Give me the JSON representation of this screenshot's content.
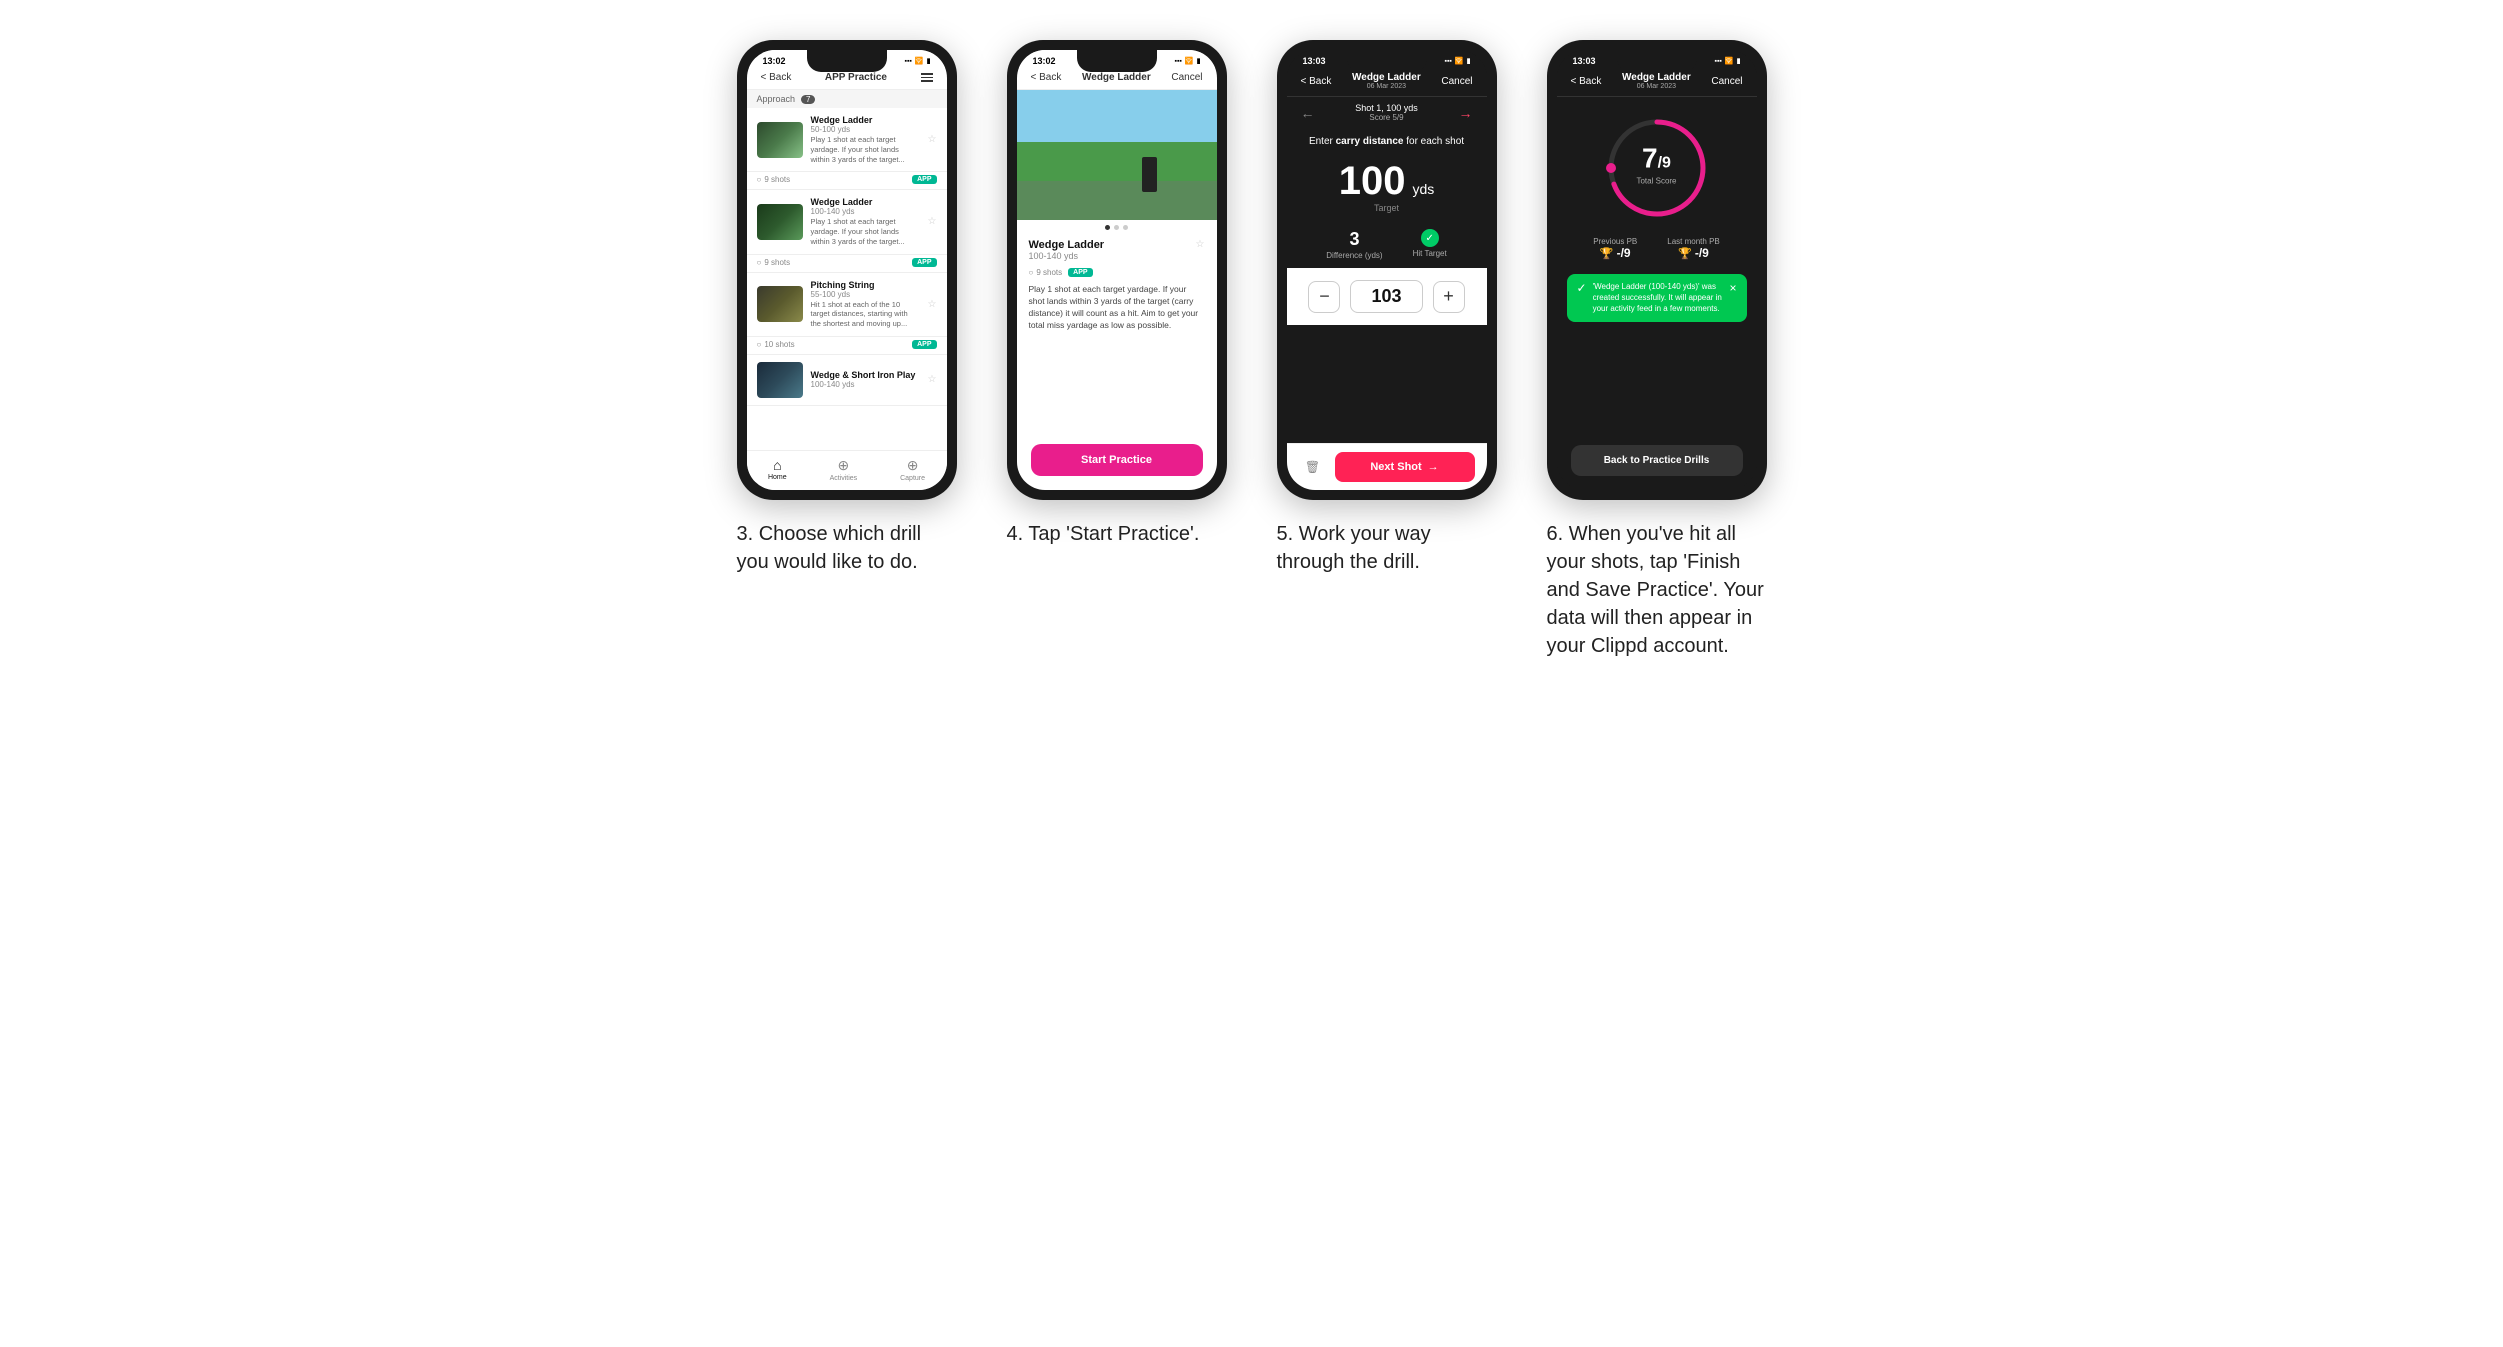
{
  "phones": [
    {
      "id": "phone3",
      "statusTime": "13:02",
      "navBack": "< Back",
      "navTitle": "APP Practice",
      "sectionHeader": "Approach",
      "sectionCount": "7",
      "drills": [
        {
          "name": "Wedge Ladder",
          "range": "50-100 yds",
          "desc": "Play 1 shot at each target yardage. If your shot lands within 3 yards of the target...",
          "shots": "9 shots",
          "badge": "APP"
        },
        {
          "name": "Wedge Ladder",
          "range": "100-140 yds",
          "desc": "Play 1 shot at each target yardage. If your shot lands within 3 yards of the target...",
          "shots": "9 shots",
          "badge": "APP"
        },
        {
          "name": "Pitching String",
          "range": "55-100 yds",
          "desc": "Hit 1 shot at each of the 10 target distances, starting with the shortest and moving up...",
          "shots": "10 shots",
          "badge": "APP"
        },
        {
          "name": "Wedge & Short Iron Play",
          "range": "100-140 yds",
          "desc": "",
          "shots": "",
          "badge": ""
        }
      ],
      "bottomNav": [
        "Home",
        "Activities",
        "Capture"
      ],
      "caption": "3. Choose which drill you would like to do."
    },
    {
      "id": "phone4",
      "statusTime": "13:02",
      "navBack": "< Back",
      "navTitle": "Wedge Ladder",
      "navRight": "Cancel",
      "drillName": "Wedge Ladder",
      "drillRange": "100-140 yds",
      "drillShots": "9 shots",
      "drillBadge": "APP",
      "drillDesc": "Play 1 shot at each target yardage. If your shot lands within 3 yards of the target (carry distance) it will count as a hit. Aim to get your total miss yardage as low as possible.",
      "startButton": "Start Practice",
      "caption": "4. Tap 'Start Practice'."
    },
    {
      "id": "phone5",
      "statusTime": "13:03",
      "navBack": "< Back",
      "navTitleMain": "Wedge Ladder",
      "navTitleSub": "06 Mar 2023",
      "navRight": "Cancel",
      "shotLabel": "Shot 1, 100 yds",
      "scoreLabel": "Score 5/9",
      "carryPrompt": "Enter carry distance for each shot",
      "targetYds": "100",
      "targetUnit": "yds",
      "targetLabel": "Target",
      "difference": "3",
      "differenceLabel": "Difference (yds)",
      "hitTarget": "Hit Target",
      "inputValue": "103",
      "nextShot": "Next Shot",
      "caption": "5. Work your way through the drill."
    },
    {
      "id": "phone6",
      "statusTime": "13:03",
      "navBack": "< Back",
      "navTitleMain": "Wedge Ladder",
      "navTitleSub": "06 Mar 2023",
      "navRight": "Cancel",
      "scoreNumber": "7",
      "scoreTotal": "/9",
      "totalScoreLabel": "Total Score",
      "previousPB": "Previous PB",
      "previousPBValue": "-/9",
      "lastMonthPB": "Last month PB",
      "lastMonthPBValue": "-/9",
      "successMessage": "'Wedge Ladder (100-140 yds)' was created successfully. It will appear in your activity feed in a few moments.",
      "backButton": "Back to Practice Drills",
      "caption": "6. When you've hit all your shots, tap 'Finish and Save Practice'. Your data will then appear in your Clippd account."
    }
  ]
}
